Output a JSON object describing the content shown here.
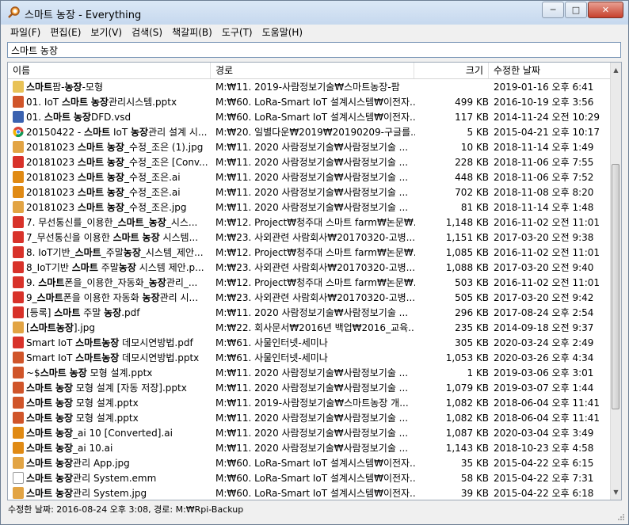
{
  "window": {
    "title": "스마트 농장 - Everything",
    "min": "─",
    "max": "□",
    "close": "✕"
  },
  "menu": [
    "파일(F)",
    "편집(E)",
    "보기(V)",
    "검색(S)",
    "책갈피(B)",
    "도구(T)",
    "도움말(H)"
  ],
  "search": {
    "value": "스마트 농장"
  },
  "columns": {
    "name": "이름",
    "path": "경로",
    "size": "크기",
    "date": "수정한 날짜"
  },
  "rows": [
    {
      "icon": "folder",
      "name": "스마트팜-농장-모형",
      "path": "M:₩11. 2019-사람정보기술₩스마트농장-팜",
      "size": "",
      "date": "2019-01-16 오후 6:41"
    },
    {
      "icon": "pptx",
      "name": "01. IoT 스마트 농장관리시스템.pptx",
      "path": "M:₩60. LoRa-Smart IoT 설계시스템₩이전자...",
      "size": "499 KB",
      "date": "2016-10-19 오후 3:56"
    },
    {
      "icon": "vsd",
      "name": "01. 스마트 농장DFD.vsd",
      "path": "M:₩60. LoRa-Smart IoT 설계시스템₩이전자...",
      "size": "117 KB",
      "date": "2014-11-24 오전 10:29"
    },
    {
      "icon": "chrome",
      "name": "20150422 - 스마트 IoT 농장관리 설계 시...",
      "path": "M:₩20. 일별다운₩2019₩20190209-구글를...",
      "size": "5 KB",
      "date": "2015-04-21 오후 10:17"
    },
    {
      "icon": "jpg",
      "name": "20181023 스마트 농장_수정_조은 (1).jpg",
      "path": "M:₩11. 2020 사람정보기술₩사람정보기술 ...",
      "size": "10 KB",
      "date": "2018-11-14 오후 1:49"
    },
    {
      "icon": "pdf",
      "name": "20181023 스마트 농장_수정_조은 [Conv...",
      "path": "M:₩11. 2020 사람정보기술₩사람정보기술 ...",
      "size": "228 KB",
      "date": "2018-11-06 오후 7:55"
    },
    {
      "icon": "ai",
      "name": "20181023 스마트 농장_수정_조은.ai",
      "path": "M:₩11. 2020 사람정보기술₩사람정보기술 ...",
      "size": "448 KB",
      "date": "2018-11-06 오후 7:52"
    },
    {
      "icon": "ai",
      "name": "20181023 스마트 농장_수정_조은.ai",
      "path": "M:₩11. 2020 사람정보기술₩사람정보기술 ...",
      "size": "702 KB",
      "date": "2018-11-08 오후 8:20"
    },
    {
      "icon": "jpg",
      "name": "20181023 스마트 농장_수정_조은.jpg",
      "path": "M:₩11. 2020 사람정보기술₩사람정보기술 ...",
      "size": "81 KB",
      "date": "2018-11-14 오후 1:48"
    },
    {
      "icon": "pdf",
      "name": "7. 무선통신를_이용한_스마트_농장_시스...",
      "path": "M:₩12. Project₩청주대 스마트 farm₩논문₩...",
      "size": "1,148 KB",
      "date": "2016-11-02 오전 11:01"
    },
    {
      "icon": "pdf",
      "name": "7_무선통신을 이용한 스마트 농장 시스템...",
      "path": "M:₩23. 사외관련 사람회사₩20170320-고병...",
      "size": "1,151 KB",
      "date": "2017-03-20 오전 9:38"
    },
    {
      "icon": "pdf",
      "name": "8. IoT기반_스마트_주말농장_시스템_제안...",
      "path": "M:₩12. Project₩청주대 스마트 farm₩논문₩...",
      "size": "1,085 KB",
      "date": "2016-11-02 오전 11:01"
    },
    {
      "icon": "pdf",
      "name": "8_IoT기반 스마트 주말농장 시스템 제안.p...",
      "path": "M:₩23. 사외관련 사람회사₩20170320-고병...",
      "size": "1,088 KB",
      "date": "2017-03-20 오전 9:40"
    },
    {
      "icon": "pdf",
      "name": "9. 스마트폰을_이용한_자동화_농장관리_...",
      "path": "M:₩12. Project₩청주대 스마트 farm₩논문₩...",
      "size": "503 KB",
      "date": "2016-11-02 오전 11:01"
    },
    {
      "icon": "pdf",
      "name": "9_스마트폰을 이용한 자동화 농장관리 시...",
      "path": "M:₩23. 사외관련 사람회사₩20170320-고병...",
      "size": "505 KB",
      "date": "2017-03-20 오전 9:42"
    },
    {
      "icon": "pdf",
      "name": "[등록] 스마트 주말 농장.pdf",
      "path": "M:₩11. 2020 사람정보기술₩사람정보기술 ...",
      "size": "296 KB",
      "date": "2017-08-24 오후 2:54"
    },
    {
      "icon": "jpg",
      "name": "[스마트농장].jpg",
      "path": "M:₩22. 회사문서₩2016년 백업₩2016_교육...",
      "size": "235 KB",
      "date": "2014-09-18 오전 9:37"
    },
    {
      "icon": "pdf",
      "name": "Smart IoT 스마트농장 데모시연방법.pdf",
      "path": "M:₩61. 사물인터넷-세미나",
      "size": "305 KB",
      "date": "2020-03-24 오후 2:49"
    },
    {
      "icon": "pptx",
      "name": "Smart IoT 스마트농장 데모시연방법.pptx",
      "path": "M:₩61. 사물인터넷-세미나",
      "size": "1,053 KB",
      "date": "2020-03-26 오후 4:34"
    },
    {
      "icon": "pptx",
      "name": "~$스마트 농장 모형 설계.pptx",
      "path": "M:₩11. 2020 사람정보기술₩사람정보기술 ...",
      "size": "1 KB",
      "date": "2019-03-06 오후 3:01"
    },
    {
      "icon": "pptx",
      "name": "스마트 농장 모형 설계 [자동 저장].pptx",
      "path": "M:₩11. 2020 사람정보기술₩사람정보기술 ...",
      "size": "1,079 KB",
      "date": "2019-03-07 오후 1:44"
    },
    {
      "icon": "pptx",
      "name": "스마트 농장 모형 설계.pptx",
      "path": "M:₩11. 2019-사람정보기술₩스마트농장 개...",
      "size": "1,082 KB",
      "date": "2018-06-04 오후 11:41"
    },
    {
      "icon": "pptx",
      "name": "스마트 농장 모형 설계.pptx",
      "path": "M:₩11. 2020 사람정보기술₩사람정보기술 ...",
      "size": "1,082 KB",
      "date": "2018-06-04 오후 11:41"
    },
    {
      "icon": "ai",
      "name": "스마트 농장_ai 10 [Converted].ai",
      "path": "M:₩11. 2020 사람정보기술₩사람정보기술 ...",
      "size": "1,087 KB",
      "date": "2020-03-04 오후 3:49"
    },
    {
      "icon": "ai",
      "name": "스마트 농장_ai 10.ai",
      "path": "M:₩11. 2020 사람정보기술₩사람정보기술 ...",
      "size": "1,143 KB",
      "date": "2018-10-23 오후 4:58"
    },
    {
      "icon": "jpg",
      "name": "스마트 농장관리 App.jpg",
      "path": "M:₩60. LoRa-Smart IoT 설계시스템₩이전자...",
      "size": "35 KB",
      "date": "2015-04-22 오후 6:15"
    },
    {
      "icon": "emm",
      "name": "스마트 농장관리 System.emm",
      "path": "M:₩60. LoRa-Smart IoT 설계시스템₩이전자...",
      "size": "58 KB",
      "date": "2015-04-22 오후 7:31"
    },
    {
      "icon": "jpg",
      "name": "스마트 농장관리 System.jpg",
      "path": "M:₩60. LoRa-Smart IoT 설계시스템₩이전자...",
      "size": "39 KB",
      "date": "2015-04-22 오후 6:18"
    }
  ],
  "status": "수정한 날짜: 2016-08-24 오후 3:08, 경로: M:₩Rpi-Backup",
  "colors": {
    "folder": "#e8c257",
    "pptx": "#d0552a",
    "pdf": "#d8322a",
    "ai": "#e08a14",
    "jpg": "#e2a444",
    "vsd": "#3b62b0",
    "emm": "#ffffff"
  }
}
